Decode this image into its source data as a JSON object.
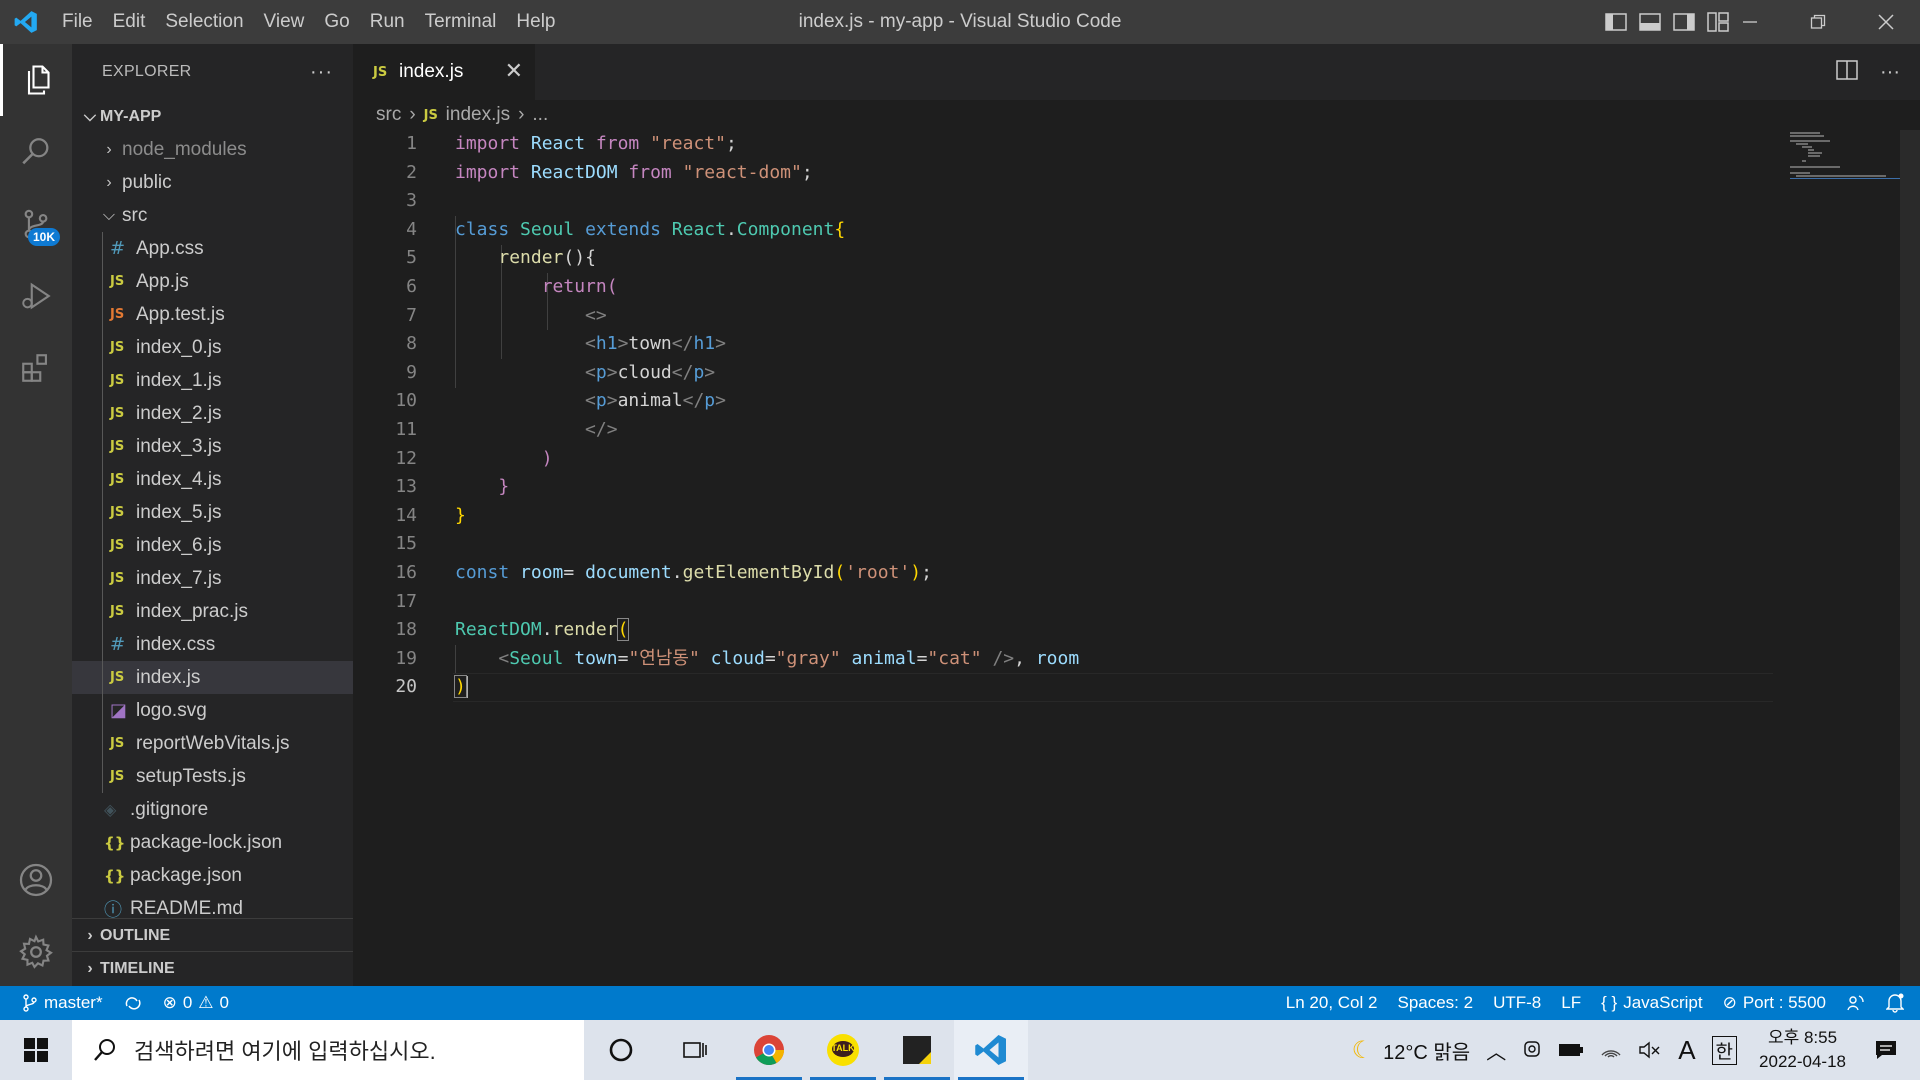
{
  "window": {
    "title": "index.js - my-app - Visual Studio Code",
    "menu": [
      "File",
      "Edit",
      "Selection",
      "View",
      "Go",
      "Run",
      "Terminal",
      "Help"
    ]
  },
  "activity": {
    "scm_badge": "10K"
  },
  "explorer": {
    "title": "EXPLORER",
    "more": "···",
    "project": "MY-APP",
    "folders": {
      "node_modules": "node_modules",
      "public": "public",
      "src": "src"
    },
    "src_files": [
      {
        "name": "App.css",
        "icon": "css"
      },
      {
        "name": "App.js",
        "icon": "js"
      },
      {
        "name": "App.test.js",
        "icon": "test"
      },
      {
        "name": "index_0.js",
        "icon": "js"
      },
      {
        "name": "index_1.js",
        "icon": "js"
      },
      {
        "name": "index_2.js",
        "icon": "js"
      },
      {
        "name": "index_3.js",
        "icon": "js"
      },
      {
        "name": "index_4.js",
        "icon": "js"
      },
      {
        "name": "index_5.js",
        "icon": "js"
      },
      {
        "name": "index_6.js",
        "icon": "js"
      },
      {
        "name": "index_7.js",
        "icon": "js"
      },
      {
        "name": "index_prac.js",
        "icon": "js"
      },
      {
        "name": "index.css",
        "icon": "css"
      },
      {
        "name": "index.js",
        "icon": "js"
      },
      {
        "name": "logo.svg",
        "icon": "svg"
      },
      {
        "name": "reportWebVitals.js",
        "icon": "js"
      },
      {
        "name": "setupTests.js",
        "icon": "js"
      }
    ],
    "root_files": [
      {
        "name": ".gitignore",
        "icon": "git"
      },
      {
        "name": "package-lock.json",
        "icon": "json"
      },
      {
        "name": "package.json",
        "icon": "json"
      },
      {
        "name": "README.md",
        "icon": "info"
      }
    ],
    "outline": "OUTLINE",
    "timeline": "TIMELINE"
  },
  "editor": {
    "tab_label": "index.js",
    "tab_icon_text": "JS",
    "breadcrumb": [
      "src",
      "index.js",
      "..."
    ],
    "line_numbers": [
      "1",
      "2",
      "3",
      "4",
      "5",
      "6",
      "7",
      "8",
      "9",
      "10",
      "11",
      "12",
      "13",
      "14",
      "15",
      "16",
      "17",
      "18",
      "19",
      "20"
    ],
    "tokens": {
      "import": "import",
      "from": "from",
      "React": "React",
      "ReactDOM": "ReactDOM",
      "react_str": "\"react\"",
      "reactdom_str": "\"react-dom\"",
      "semi": ";",
      "class": "class",
      "Seoul": "Seoul",
      "extends": "extends",
      "dot": ".",
      "Component": "Component",
      "lbrace": "{",
      "rbrace": "}",
      "render": "render",
      "parens_brace": "(){",
      "return": "return",
      "lparen": "(",
      "rparen": ")",
      "frag_open": "<>",
      "frag_close": "</>",
      "lt": "<",
      "lt_slash": "</",
      "gt": ">",
      "h1": "h1",
      "p": "p",
      "town": "town",
      "cloud": "cloud",
      "animal": "animal",
      "const": "const",
      "room": "room",
      "eq": "=",
      "document": "document",
      "getElementById": "getElementById",
      "root_str": "'root'",
      "rparen_semi": ");",
      "town_attr": "town",
      "town_val": "\"연남동\"",
      "cloud_attr": "cloud",
      "cloud_val": "\"gray\"",
      "animal_attr": "animal",
      "animal_val": "\"cat\"",
      "self_close": "/>",
      "comma": ","
    }
  },
  "status": {
    "branch": "master*",
    "errors": "0",
    "warnings": "0",
    "position": "Ln 20, Col 2",
    "spaces": "Spaces: 2",
    "encoding": "UTF-8",
    "eol": "LF",
    "language": "JavaScript",
    "port": "Port : 5500"
  },
  "taskbar": {
    "search_placeholder": "검색하려면 여기에 입력하십시오.",
    "weather": "12°C 맑음",
    "ime_a": "A",
    "ime_han": "한",
    "time": "오후 8:55",
    "date": "2022-04-18",
    "kakao_label": "TALK"
  },
  "colors": {
    "accent": "#007acc",
    "titlebar": "#3c3c3c",
    "sidebar": "#252526",
    "editor": "#1e1e1e"
  }
}
